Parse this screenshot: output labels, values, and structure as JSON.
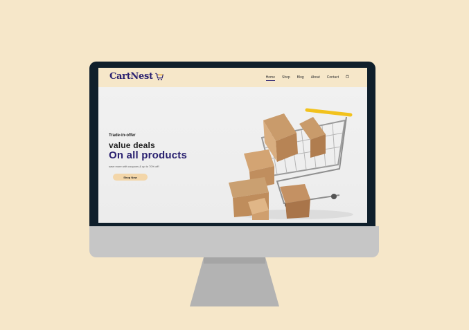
{
  "site": {
    "brand": "CartNest",
    "nav": [
      {
        "label": "Home",
        "active": true
      },
      {
        "label": "Shop",
        "active": false
      },
      {
        "label": "Blog",
        "active": false
      },
      {
        "label": "About",
        "active": false
      },
      {
        "label": "Contact",
        "active": false
      }
    ],
    "nav_icon": "cart-icon",
    "hero": {
      "kicker": "Trade-in-offer",
      "headline_1": "value deals",
      "headline_2": "On all products",
      "subtext": "save more with coupons & up to 70% off!",
      "cta_label": "Shop Now"
    }
  },
  "colors": {
    "page_bg": "#f6e7c9",
    "brand_blue": "#2a2170",
    "bezel": "#0f1f2b",
    "button": "#f3d6a9"
  }
}
